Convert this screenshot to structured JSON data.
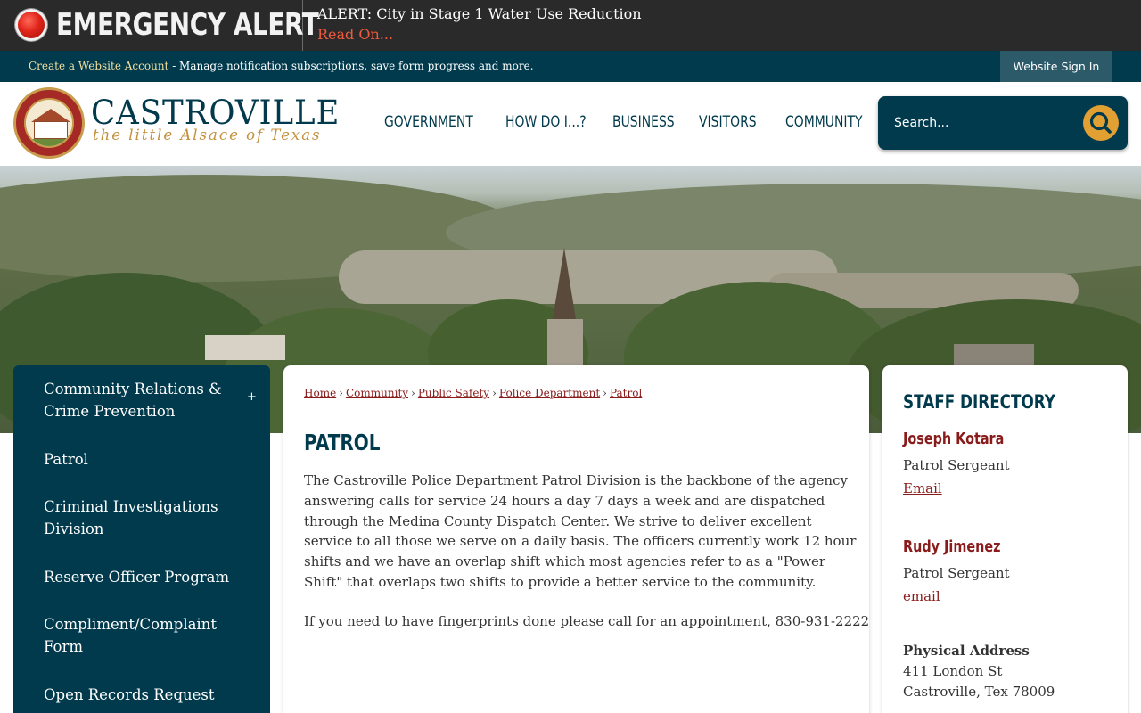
{
  "alert": {
    "title": "EMERGENCY ALERT",
    "message": "ALERT: City in Stage 1 Water Use Reduction",
    "link": "Read On..."
  },
  "account_bar": {
    "create_link": "Create a Website Account",
    "description": " - Manage notification subscriptions, save form progress and more.",
    "sign_in": "Website Sign In"
  },
  "logo": {
    "name": "CASTROVILLE",
    "tagline": "the little Alsace of Texas",
    "seal_text": "CASTROVILLE · THE LITTLE ALSACE OF TEXAS · 1844"
  },
  "nav": {
    "items": [
      "GOVERNMENT",
      "HOW DO I...?",
      "BUSINESS",
      "VISITORS",
      "COMMUNITY"
    ]
  },
  "search": {
    "placeholder": "Search..."
  },
  "sidebar": {
    "items": [
      "Community Relations & Crime Prevention",
      "Patrol",
      "Criminal Investigations Division",
      "Reserve Officer Program",
      "Compliment/Complaint Form",
      "Open Records Request"
    ],
    "expand_symbol": "+"
  },
  "breadcrumb": {
    "items": [
      "Home",
      "Community",
      "Public Safety",
      "Police Department",
      "Patrol"
    ],
    "separator": "›"
  },
  "main": {
    "title": "PATROL",
    "paragraph1": "The Castroville Police Department Patrol Division is the backbone of the agency answering calls for service 24 hours a day 7 days a week and are dispatched through the Medina County Dispatch Center.  We strive to deliver excellent service to all those we serve on a daily basis. The officers currently work 12 hour shifts and we have an overlap shift which most agencies refer to as a \"Power Shift\" that overlaps two shifts to provide a better service to the community.",
    "paragraph2": "If you need to have fingerprints done please call for an appointment, 830-931-2222"
  },
  "staff_directory": {
    "title": "STAFF DIRECTORY",
    "staff": [
      {
        "name": "Joseph Kotara",
        "role": "Patrol Sergeant",
        "email_label": "Email"
      },
      {
        "name": "Rudy Jimenez",
        "role": "Patrol Sergeant",
        "email_label": "email"
      }
    ],
    "address_label": "Physical Address",
    "address_line1": "411 London St",
    "address_line2": "Castroville, Tex 78009"
  },
  "colors": {
    "alert_bg": "#2a2a2a",
    "brand_navy": "#003a4c",
    "accent_gold": "#e2a033",
    "link_red": "#8a1b1b",
    "alert_link": "#ef5a3e"
  },
  "icons": {
    "alert": "alert-light-icon",
    "search": "search-icon",
    "expand": "plus-icon"
  }
}
